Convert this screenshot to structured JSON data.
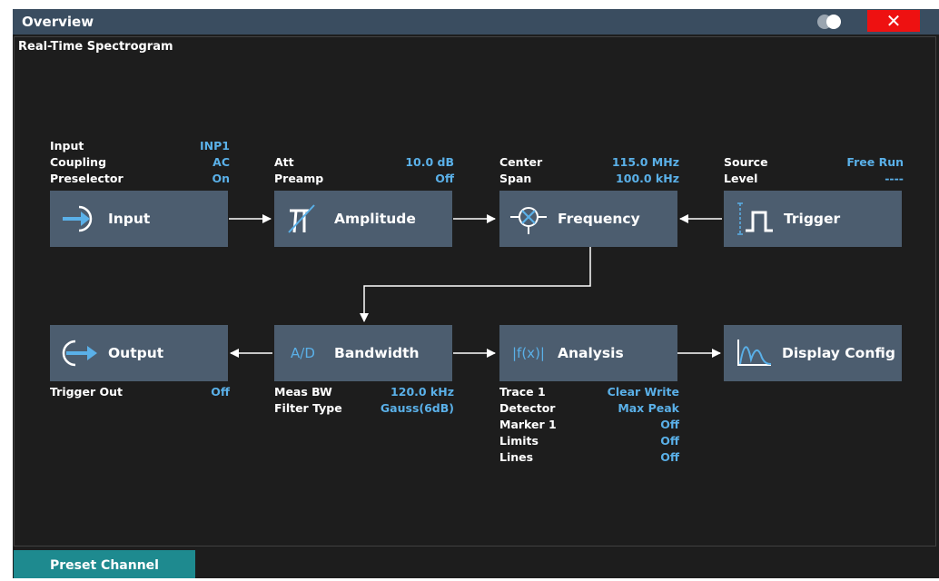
{
  "window": {
    "title": "Overview"
  },
  "panel": {
    "title": "Real-Time Spectrogram"
  },
  "blocks": {
    "input": {
      "label": "Input"
    },
    "amplitude": {
      "label": "Amplitude"
    },
    "frequency": {
      "label": "Frequency"
    },
    "trigger": {
      "label": "Trigger"
    },
    "output": {
      "label": "Output"
    },
    "bandwidth": {
      "label": "Bandwidth",
      "icon_text": "A/D"
    },
    "analysis": {
      "label": "Analysis",
      "icon_text": "|f(x)|"
    },
    "display": {
      "label": "Display Config"
    }
  },
  "params": {
    "input": [
      {
        "key": "Input",
        "value": "INP1"
      },
      {
        "key": "Coupling",
        "value": "AC"
      },
      {
        "key": "Preselector",
        "value": "On"
      }
    ],
    "amplitude": [
      {
        "key": "Att",
        "value": "10.0 dB"
      },
      {
        "key": "Preamp",
        "value": "Off"
      }
    ],
    "frequency": [
      {
        "key": "Center",
        "value": "115.0 MHz"
      },
      {
        "key": "Span",
        "value": "100.0 kHz"
      }
    ],
    "trigger": [
      {
        "key": "Source",
        "value": "Free Run"
      },
      {
        "key": "Level",
        "value": "----"
      }
    ],
    "output": [
      {
        "key": "Trigger Out",
        "value": "Off"
      }
    ],
    "bandwidth": [
      {
        "key": "Meas BW",
        "value": "120.0 kHz"
      },
      {
        "key": "Filter Type",
        "value": "Gauss(6dB)"
      }
    ],
    "analysis": [
      {
        "key": "Trace 1",
        "value": "Clear Write"
      },
      {
        "key": "Detector",
        "value": "Max Peak"
      },
      {
        "key": "Marker 1",
        "value": "Off"
      },
      {
        "key": "Limits",
        "value": "Off"
      },
      {
        "key": "Lines",
        "value": "Off"
      }
    ]
  },
  "footer": {
    "preset_label": "Preset Channel"
  },
  "colors": {
    "titlebar": "#3a4d60",
    "block": "#4c5d6f",
    "accent": "#5ab0e8",
    "close": "#ee1111",
    "preset": "#1e8a8f"
  },
  "icons": {
    "input": "arrow-into-circle-icon",
    "amplitude": "attenuator-icon",
    "frequency": "mixer-icon",
    "trigger": "pulse-icon",
    "output": "arrow-out-circle-icon",
    "display": "spectrum-curve-icon",
    "toggle": "theme-toggle-icon",
    "close": "close-icon"
  }
}
